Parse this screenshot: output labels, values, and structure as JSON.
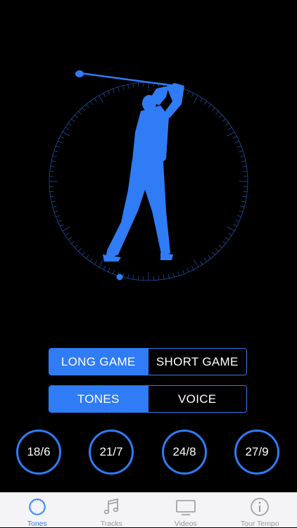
{
  "colors": {
    "accent": "#2F7CF6",
    "background": "#000000",
    "tabbar": "#F4F4F6",
    "inactive": "#9A9A9A"
  },
  "hero": {
    "graphic": "golfer-silhouette-on-clock-dial",
    "icon": "golfer-icon"
  },
  "game_segment": {
    "options": [
      "LONG GAME",
      "SHORT GAME"
    ],
    "selected": "LONG GAME"
  },
  "mode_segment": {
    "options": [
      "TONES",
      "VOICE"
    ],
    "selected": "TONES"
  },
  "tempos": [
    "18/6",
    "21/7",
    "24/8",
    "27/9"
  ],
  "tabs": [
    {
      "label": "Tones",
      "icon": "dial-icon",
      "active": true
    },
    {
      "label": "Tracks",
      "icon": "music-note-icon",
      "active": false
    },
    {
      "label": "Videos",
      "icon": "tv-icon",
      "active": false
    },
    {
      "label": "Tour Tempo",
      "icon": "info-icon",
      "active": false
    }
  ]
}
